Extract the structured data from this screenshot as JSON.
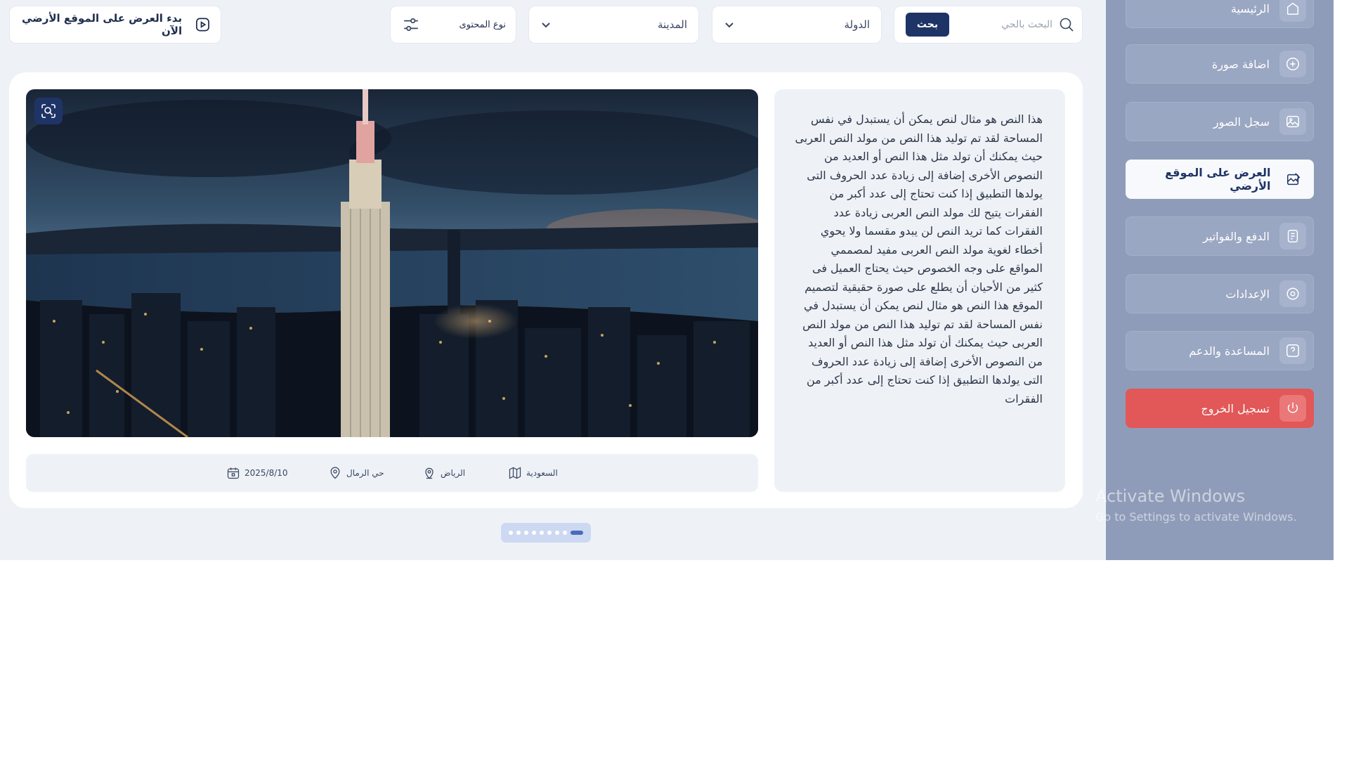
{
  "sidebar": {
    "items": [
      {
        "label": "الرئيسية",
        "icon": "home-icon"
      },
      {
        "label": "اضافة صورة",
        "icon": "plus-circle-icon"
      },
      {
        "label": "سجل الصور",
        "icon": "gallery-icon"
      },
      {
        "label": "العرض على الموقع الأرضي",
        "icon": "image-edit-icon",
        "active": true
      },
      {
        "label": "الدفع والفواتير",
        "icon": "invoice-icon"
      },
      {
        "label": "الإعدادات",
        "icon": "settings-icon"
      },
      {
        "label": "المساعدة والدعم",
        "icon": "help-icon"
      }
    ],
    "logout": {
      "label": "تسجيل الخروج",
      "icon": "power-icon"
    }
  },
  "watermark": {
    "title": "Activate Windows",
    "subtitle": "Go to Settings to activate Windows."
  },
  "topbar": {
    "search": {
      "placeholder": "البحث بالحي",
      "button": "بحث"
    },
    "country": {
      "value": "الدولة"
    },
    "city": {
      "value": "المدينة"
    },
    "content_type": {
      "value": "نوع المحتوى"
    },
    "start_display": {
      "label": "بدء العرض على الموقع الأرضي الآن"
    }
  },
  "post": {
    "description": "هذا النص هو مثال لنص يمكن أن يستبدل في نفس المساحة لقد تم توليد هذا النص من مولد النص العربى حيث يمكنك أن تولد مثل هذا النص أو العديد من النصوص الأخرى إضافة إلى زيادة عدد الحروف التى يولدها التطبيق إذا كنت تحتاج إلى عدد أكبر من الفقرات يتيح لك مولد النص العربى زيادة عدد الفقرات كما تريد النص لن يبدو مقسما ولا يحوي أخطاء لغوية مولد النص العربى مفيد لمصممي المواقع على وجه الخصوص حيث يحتاج العميل فى كثير من الأحيان أن يطلع على صورة حقيقية لتصميم الموقع هذا النص هو مثال لنص يمكن أن يستبدل في نفس المساحة لقد تم توليد هذا النص من مولد النص العربى حيث يمكنك أن تولد مثل هذا النص أو العديد من النصوص الأخرى إضافة إلى زيادة عدد الحروف التى يولدها التطبيق إذا كنت تحتاج إلى عدد أكبر من الفقرات",
    "meta": {
      "country": "السعودية",
      "city": "الرياض",
      "district": "حي الرمال",
      "date": "2025/8/10"
    }
  },
  "pagination": {
    "total": 9,
    "active_index": 8
  },
  "colors": {
    "primary": "#1f3466",
    "sidebar": "#8f9cb9",
    "logout": "#e25757",
    "page_bg": "#eef2f7"
  }
}
